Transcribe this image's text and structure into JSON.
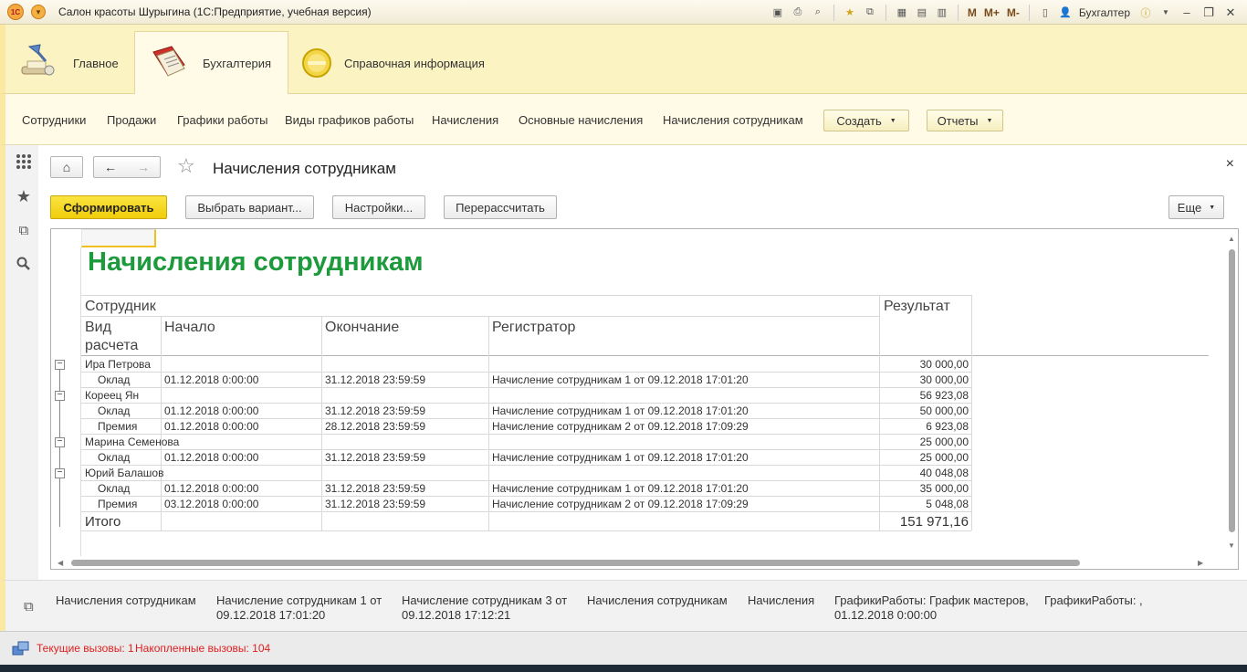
{
  "window": {
    "title": "Салон красоты Шурыгина  (1С:Предприятие, учебная версия)",
    "toolbar_m": [
      "M",
      "M+",
      "M-"
    ],
    "user": "Бухгалтер"
  },
  "sections": [
    {
      "label": "Главное",
      "icon": "desk-lamp-icon"
    },
    {
      "label": "Бухгалтерия",
      "icon": "ledger-book-icon",
      "active": true
    },
    {
      "label": "Справочная информация",
      "icon": "info-disc-icon"
    }
  ],
  "function_panel": {
    "items": [
      "Сотрудники",
      "Продажи",
      "Графики работы",
      "Виды графиков работы",
      "Начисления",
      "Основные начисления",
      "Начисления сотрудникам"
    ],
    "create_label": "Создать",
    "reports_label": "Отчеты"
  },
  "form": {
    "title": "Начисления сотрудникам",
    "close": "×",
    "buttons": {
      "generate": "Сформировать",
      "choose_variant": "Выбрать вариант...",
      "settings": "Настройки...",
      "recalc": "Перерассчитать",
      "more": "Еще"
    }
  },
  "report": {
    "title": "Начисления сотрудникам",
    "headers": {
      "employee": "Сотрудник",
      "result": "Результат",
      "calc_type_1": "Вид",
      "calc_type_2": "расчета",
      "start": "Начало",
      "end": "Окончание",
      "registrar": "Регистратор"
    },
    "rows": [
      {
        "type": "group",
        "name": "Ира Петрова",
        "result": "30 000,00"
      },
      {
        "type": "detail",
        "kind": "Оклад",
        "start": "01.12.2018 0:00:00",
        "end": "31.12.2018 23:59:59",
        "registrar": "Начисление сотрудникам 1 от 09.12.2018 17:01:20",
        "result": "30 000,00"
      },
      {
        "type": "group",
        "name": "Кореец Ян",
        "result": "56 923,08"
      },
      {
        "type": "detail",
        "kind": "Оклад",
        "start": "01.12.2018 0:00:00",
        "end": "31.12.2018 23:59:59",
        "registrar": "Начисление сотрудникам 1 от 09.12.2018 17:01:20",
        "result": "50 000,00"
      },
      {
        "type": "detail",
        "kind": "Премия",
        "start": "01.12.2018 0:00:00",
        "end": "28.12.2018 23:59:59",
        "registrar": "Начисление сотрудникам 2 от 09.12.2018 17:09:29",
        "result": "6 923,08"
      },
      {
        "type": "group",
        "name": "Марина Семенова",
        "result": "25 000,00"
      },
      {
        "type": "detail",
        "kind": "Оклад",
        "start": "01.12.2018 0:00:00",
        "end": "31.12.2018 23:59:59",
        "registrar": "Начисление сотрудникам 1 от 09.12.2018 17:01:20",
        "result": "25 000,00"
      },
      {
        "type": "group",
        "name": "Юрий Балашов",
        "result": "40 048,08"
      },
      {
        "type": "detail",
        "kind": "Оклад",
        "start": "01.12.2018 0:00:00",
        "end": "31.12.2018 23:59:59",
        "registrar": "Начисление сотрудникам 1 от 09.12.2018 17:01:20",
        "result": "35 000,00"
      },
      {
        "type": "detail",
        "kind": "Премия",
        "start": "03.12.2018 0:00:00",
        "end": "31.12.2018 23:59:59",
        "registrar": "Начисление сотрудникам 2 от 09.12.2018 17:09:29",
        "result": "5 048,08"
      }
    ],
    "total_label": "Итого",
    "total_value": "151 971,16",
    "group_toggle": "−"
  },
  "history": [
    {
      "line1": "Начисления сотрудникам",
      "line2": ""
    },
    {
      "line1": "Начисление сотрудникам 1 от",
      "line2": "09.12.2018 17:01:20"
    },
    {
      "line1": "Начисление сотрудникам 3 от",
      "line2": "09.12.2018 17:12:21"
    },
    {
      "line1": "Начисления сотрудникам",
      "line2": ""
    },
    {
      "line1": "Начисления",
      "line2": ""
    },
    {
      "line1": "ГрафикиРаботы: График мастеров,",
      "line2": "01.12.2018 0:00:00"
    },
    {
      "line1": "ГрафикиРаботы: ,",
      "line2": ""
    }
  ],
  "status": {
    "current_calls": "Текущие вызовы: 1",
    "accumulated_calls": "Накопленные вызовы: 104"
  }
}
